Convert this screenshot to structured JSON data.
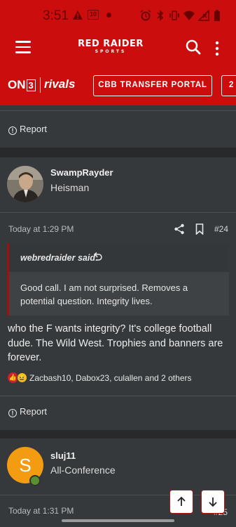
{
  "status_bar": {
    "time": "3:51",
    "icons": [
      "warning-icon",
      "nfl-badge-icon",
      "dot-icon",
      "alarm-icon",
      "bluetooth-icon",
      "vibrate-icon",
      "wifi-icon",
      "signal-icon",
      "battery-icon"
    ],
    "badge_text": "10"
  },
  "navbar": {
    "logo_main": "RED RAIDER",
    "logo_sub": "SPORTS",
    "icons": [
      "menu-icon",
      "search-icon",
      "more-vertical-icon"
    ]
  },
  "partnerbar": {
    "on3_prefix": "ON",
    "on3_num": "3",
    "rivals": "rivals",
    "portal_button": "CBB TRANSFER PORTAL",
    "next_button": "2"
  },
  "posts": [
    {
      "report_label": "Report"
    },
    {
      "author": "SwampRayder",
      "title": "Heisman",
      "timestamp": "Today at 1:29 PM",
      "post_number": "#24",
      "quote_author": "webredraider said:",
      "quote_text": "Good call. I am not surprised. Removes a potential question. Integrity lives.",
      "body": "who the F wants integrity? It's college football dude. The Wild West. Trophies and banners are forever.",
      "reactions_text": "Zacbash10, Dabox23, culallen and 2 others",
      "report_label": "Report"
    },
    {
      "author": "sluj11",
      "title": "All-Conference",
      "avatar_letter": "S",
      "timestamp": "Today at 1:31 PM",
      "post_number": "#25"
    }
  ],
  "colors": {
    "brand_red": "#cc0d0d",
    "background": "#2b2e30",
    "card": "#35393b",
    "avatar_orange": "#f39c12"
  }
}
